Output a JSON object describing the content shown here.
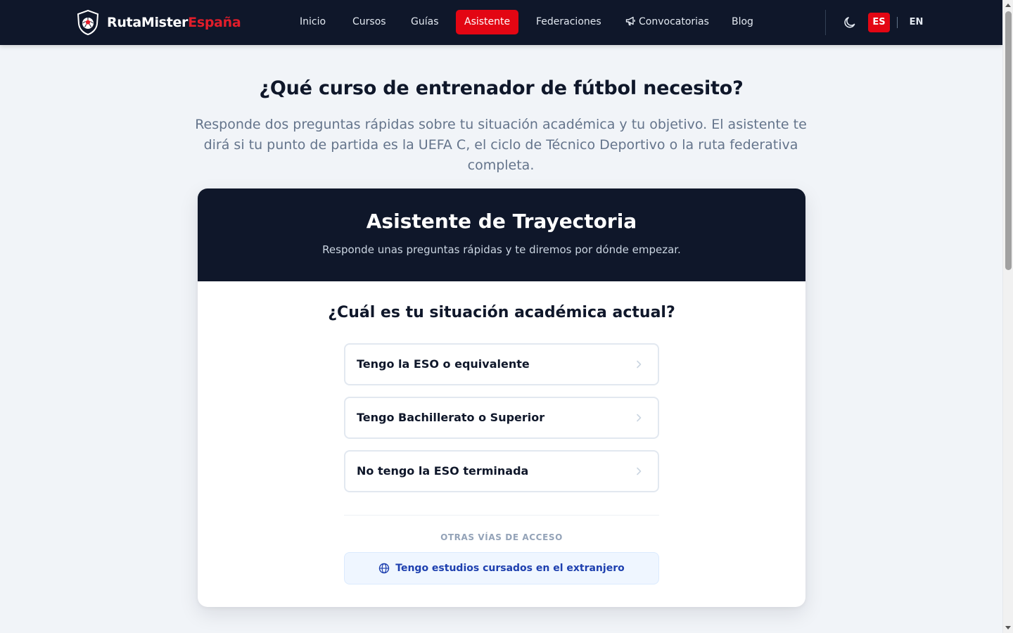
{
  "brand": {
    "name_main": "RutaMister",
    "name_accent": "España"
  },
  "nav": {
    "items": [
      {
        "label": "Inicio"
      },
      {
        "label": "Cursos"
      },
      {
        "label": "Guías"
      },
      {
        "label": "Asistente",
        "active": true
      },
      {
        "label": "Federaciones"
      },
      {
        "label": "Convocatorias",
        "icon": "megaphone-icon"
      },
      {
        "label": "Blog"
      }
    ],
    "lang_es": "ES",
    "lang_en": "EN",
    "theme_icon": "moon-icon"
  },
  "hero": {
    "title": "¿Qué curso de entrenador de fútbol necesito?",
    "subtitle": "Responde dos preguntas rápidas sobre tu situación académica y tu objetivo. El asistente te dirá si tu punto de partida es la UEFA C, el ciclo de Técnico Deportivo o la ruta federativa completa."
  },
  "wizard": {
    "title": "Asistente de Trayectoria",
    "subtitle": "Responde unas preguntas rápidas y te diremos por dónde empezar.",
    "question": "¿Cuál es tu situación académica actual?",
    "options": [
      {
        "label": "Tengo la ESO o equivalente"
      },
      {
        "label": "Tengo Bachillerato o Superior"
      },
      {
        "label": "No tengo la ESO terminada"
      }
    ],
    "other_label": "OTRAS VÍAS DE ACCESO",
    "foreign_label": "Tengo estudios cursados en el extranjero",
    "foreign_icon": "globe-icon"
  },
  "colors": {
    "nav_bg": "#0f172a",
    "accent": "#e30613",
    "page_bg": "#f1f4f8",
    "link_blue": "#1e40af"
  }
}
